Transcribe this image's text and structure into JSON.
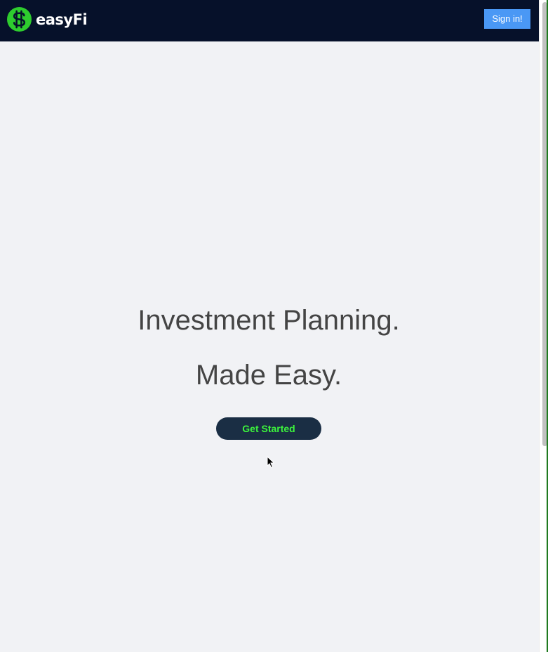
{
  "header": {
    "brand_name": "easyFi",
    "logo_icon": "dollar-coin-icon",
    "signin_label": "Sign in!"
  },
  "hero": {
    "line1": "Investment Planning.",
    "line2": "Made Easy.",
    "cta_label": "Get Started"
  },
  "colors": {
    "nav_background": "#06112a",
    "page_background": "#f1f2f5",
    "logo_green": "#2ecc2e",
    "signin_button": "#4a98f5",
    "cta_background": "#1a2e44",
    "cta_text": "#3cf53c",
    "hero_text": "#444444"
  }
}
